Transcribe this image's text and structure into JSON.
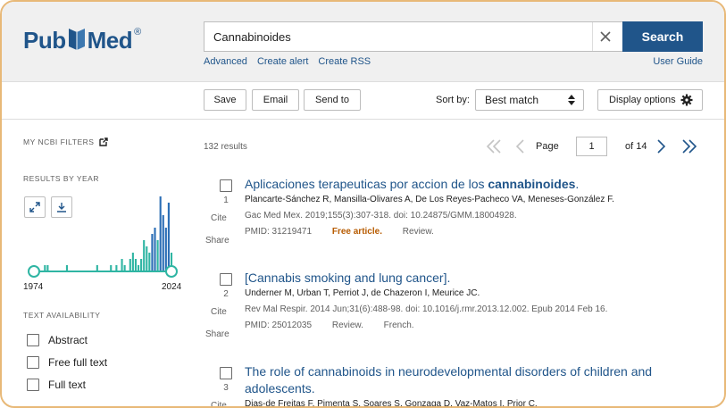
{
  "header": {
    "logo_pub": "Pub",
    "logo_med": "Med",
    "logo_reg": "®",
    "search_value": "Cannabinoides",
    "search_button": "Search",
    "links": [
      "Advanced",
      "Create alert",
      "Create RSS"
    ],
    "user_guide": "User Guide"
  },
  "toolbar": {
    "save": "Save",
    "email": "Email",
    "send_to": "Send to",
    "sort_by_label": "Sort by:",
    "sort_value": "Best match",
    "display_options": "Display options"
  },
  "sidebar": {
    "my_ncbi_filters": "MY NCBI FILTERS",
    "results_by_year": "RESULTS BY YEAR",
    "year_start": "1974",
    "year_end": "2024",
    "text_availability": "TEXT AVAILABILITY",
    "filters": [
      "Abstract",
      "Free full text",
      "Full text"
    ]
  },
  "chart_data": {
    "type": "bar",
    "title": "",
    "xlabel": "",
    "ylabel": "",
    "x_range": [
      1974,
      2024
    ],
    "x": [
      1974,
      1975,
      1976,
      1977,
      1978,
      1979,
      1980,
      1981,
      1982,
      1983,
      1984,
      1985,
      1986,
      1987,
      1988,
      1989,
      1990,
      1991,
      1992,
      1993,
      1994,
      1995,
      1996,
      1997,
      1998,
      1999,
      2000,
      2001,
      2002,
      2003,
      2004,
      2005,
      2006,
      2007,
      2008,
      2009,
      2010,
      2011,
      2012,
      2013,
      2014,
      2015,
      2016,
      2017,
      2018,
      2019,
      2020,
      2021,
      2022,
      2023,
      2024
    ],
    "values": [
      1,
      0,
      0,
      0,
      1,
      1,
      0,
      0,
      0,
      0,
      0,
      0,
      1,
      0,
      0,
      0,
      0,
      0,
      0,
      0,
      0,
      0,
      0,
      1,
      0,
      0,
      0,
      0,
      1,
      0,
      1,
      0,
      2,
      1,
      0,
      2,
      3,
      2,
      1,
      2,
      5,
      4,
      3,
      6,
      7,
      5,
      12,
      9,
      7,
      11,
      3
    ],
    "ylim": [
      0,
      12
    ]
  },
  "results": {
    "count": "132 results",
    "page_label": "Page",
    "page_value": "1",
    "of_label": "of 14",
    "articles": [
      {
        "num": "1",
        "title_prefix": "Aplicaciones terapeuticas por accion de los ",
        "title_bold": "cannabinoides",
        "title_suffix": ".",
        "authors": "Plancarte-Sánchez R, Mansilla-Olivares A, De Los Reyes-Pacheco VA, Meneses-González F.",
        "citation": "Gac Med Mex. 2019;155(3):307-318. doi: 10.24875/GMM.18004928.",
        "pmid": "PMID: 31219471",
        "free": "Free article.",
        "type": "Review.",
        "lang": ""
      },
      {
        "num": "2",
        "title_prefix": "[Cannabis smoking and lung cancer].",
        "title_bold": "",
        "title_suffix": "",
        "authors": "Underner M, Urban T, Perriot J, de Chazeron I, Meurice JC.",
        "citation": "Rev Mal Respir. 2014 Jun;31(6):488-98. doi: 10.1016/j.rmr.2013.12.002. Epub 2014 Feb 16.",
        "pmid": "PMID: 25012035",
        "free": "",
        "type": "Review.",
        "lang": "French."
      },
      {
        "num": "3",
        "title_prefix": "The role of cannabinoids in neurodevelopmental disorders of children and adolescents.",
        "title_bold": "",
        "title_suffix": "",
        "authors": "Dias-de Freitas F, Pimenta S, Soares S, Gonzaga D, Vaz-Matos I, Prior C.",
        "citation": "",
        "pmid": "",
        "free": "",
        "type": "",
        "lang": ""
      }
    ],
    "cite_label": "Cite",
    "share_label": "Share"
  },
  "colors": {
    "brand": "#20558a",
    "bar_teal": "#2fb5a3",
    "bar_blue": "#2a6db5",
    "free": "#b75b00"
  }
}
